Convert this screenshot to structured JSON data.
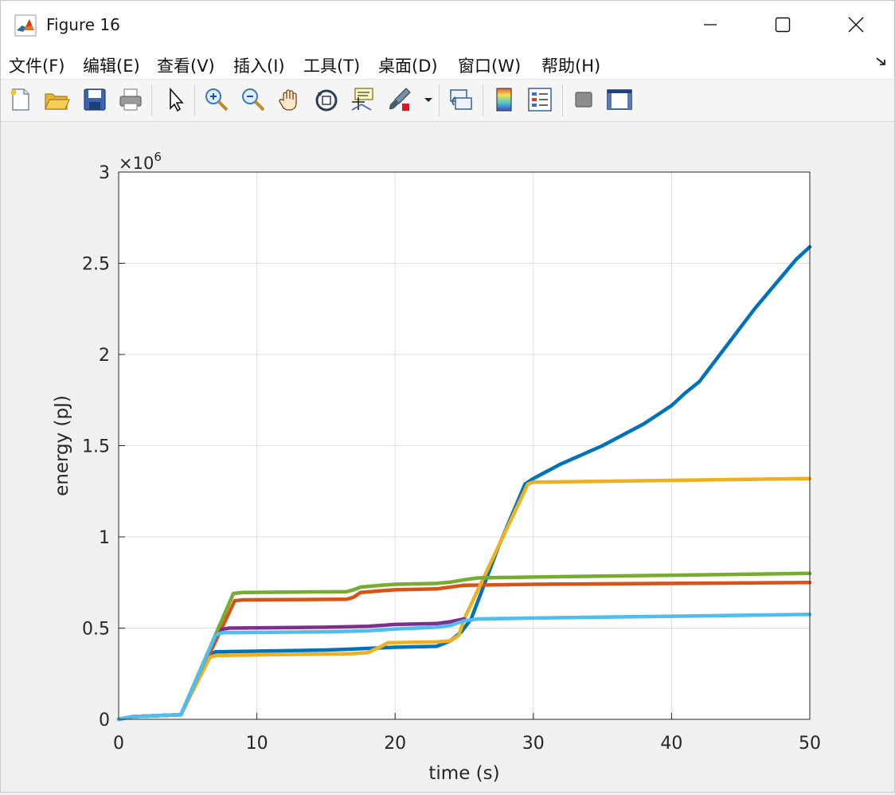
{
  "window": {
    "title": "Figure 16",
    "buttons": [
      "minimize",
      "maximize",
      "close"
    ]
  },
  "menubar": {
    "items": [
      "文件(F)",
      "编辑(E)",
      "查看(V)",
      "插入(I)",
      "工具(T)",
      "桌面(D)",
      "窗口(W)",
      "帮助(H)"
    ],
    "dock_icon": "dock-arrow-icon"
  },
  "toolbar": {
    "icons": [
      "new-figure-icon",
      "open-icon",
      "save-icon",
      "print-icon",
      "pointer-icon",
      "zoom-in-icon",
      "zoom-out-icon",
      "pan-icon",
      "rotate-3d-icon",
      "data-cursor-icon",
      "brush-icon",
      "brush-dropdown-icon",
      "link-plot-icon",
      "colorbar-icon",
      "legend-icon",
      "hide-plot-tools-icon",
      "show-plot-tools-icon"
    ]
  },
  "chart_data": {
    "type": "line",
    "xlabel": "time (s)",
    "ylabel": "energy (pJ)",
    "exponent_label": "×10",
    "exponent_power": "6",
    "xlim": [
      0,
      50
    ],
    "ylim": [
      0,
      3000000
    ],
    "xticks": [
      0,
      10,
      20,
      30,
      40,
      50
    ],
    "xtick_labels": [
      "0",
      "10",
      "20",
      "30",
      "40",
      "50"
    ],
    "yticks": [
      0,
      500000,
      1000000,
      1500000,
      2000000,
      2500000,
      3000000
    ],
    "ytick_labels": [
      "0",
      "0.5",
      "1",
      "1.5",
      "2",
      "2.5",
      "3"
    ],
    "grid": true,
    "series": [
      {
        "color": "#0072BD",
        "x": [
          0,
          1,
          4.5,
          6.6,
          7,
          15,
          17,
          20,
          23,
          24,
          24.8,
          25.5,
          27.5,
          29.4,
          30,
          32,
          35,
          38,
          40,
          41,
          42,
          44,
          46,
          48,
          49,
          50
        ],
        "y": [
          0,
          15000,
          25000,
          350000,
          370000,
          380000,
          385000,
          395000,
          400000,
          430000,
          480000,
          550000,
          950000,
          1290000,
          1320000,
          1400000,
          1500000,
          1620000,
          1720000,
          1790000,
          1850000,
          2050000,
          2250000,
          2430000,
          2520000,
          2590000
        ]
      },
      {
        "color": "#D95319",
        "x": [
          0,
          1,
          4.5,
          8.4,
          9,
          16.5,
          17,
          17.5,
          19,
          20,
          23,
          24,
          25,
          30,
          40,
          50
        ],
        "y": [
          0,
          15000,
          25000,
          650000,
          655000,
          658000,
          670000,
          695000,
          705000,
          710000,
          715000,
          725000,
          735000,
          740000,
          745000,
          750000
        ]
      },
      {
        "color": "#EDB120",
        "x": [
          0,
          1,
          4.5,
          6.6,
          7,
          16.8,
          18,
          19,
          19.5,
          20,
          23,
          24,
          24.6,
          25,
          29.6,
          30,
          40,
          50
        ],
        "y": [
          0,
          15000,
          25000,
          340000,
          350000,
          360000,
          365000,
          400000,
          420000,
          420000,
          425000,
          430000,
          460000,
          550000,
          1290000,
          1300000,
          1310000,
          1320000
        ]
      },
      {
        "color": "#7E2F8E",
        "x": [
          0,
          1,
          4.5,
          7.2,
          8,
          15,
          18,
          19,
          20,
          23,
          24,
          25
        ],
        "y": [
          0,
          15000,
          25000,
          490000,
          500000,
          505000,
          510000,
          515000,
          520000,
          525000,
          535000,
          550000
        ]
      },
      {
        "color": "#77AC30",
        "x": [
          0,
          1,
          4.5,
          8.3,
          9,
          16.5,
          17,
          17.5,
          19,
          20,
          23,
          24,
          25,
          26,
          30,
          40,
          50
        ],
        "y": [
          0,
          15000,
          25000,
          690000,
          695000,
          700000,
          710000,
          725000,
          735000,
          740000,
          745000,
          752000,
          765000,
          775000,
          780000,
          790000,
          800000
        ]
      },
      {
        "color": "#4DBEEE",
        "x": [
          0,
          1,
          4.5,
          7,
          7.5,
          15,
          18,
          20,
          23,
          24,
          25,
          26,
          30,
          40,
          50
        ],
        "y": [
          0,
          15000,
          25000,
          460000,
          475000,
          480000,
          485000,
          495000,
          505000,
          515000,
          540000,
          550000,
          555000,
          565000,
          575000
        ]
      }
    ]
  }
}
